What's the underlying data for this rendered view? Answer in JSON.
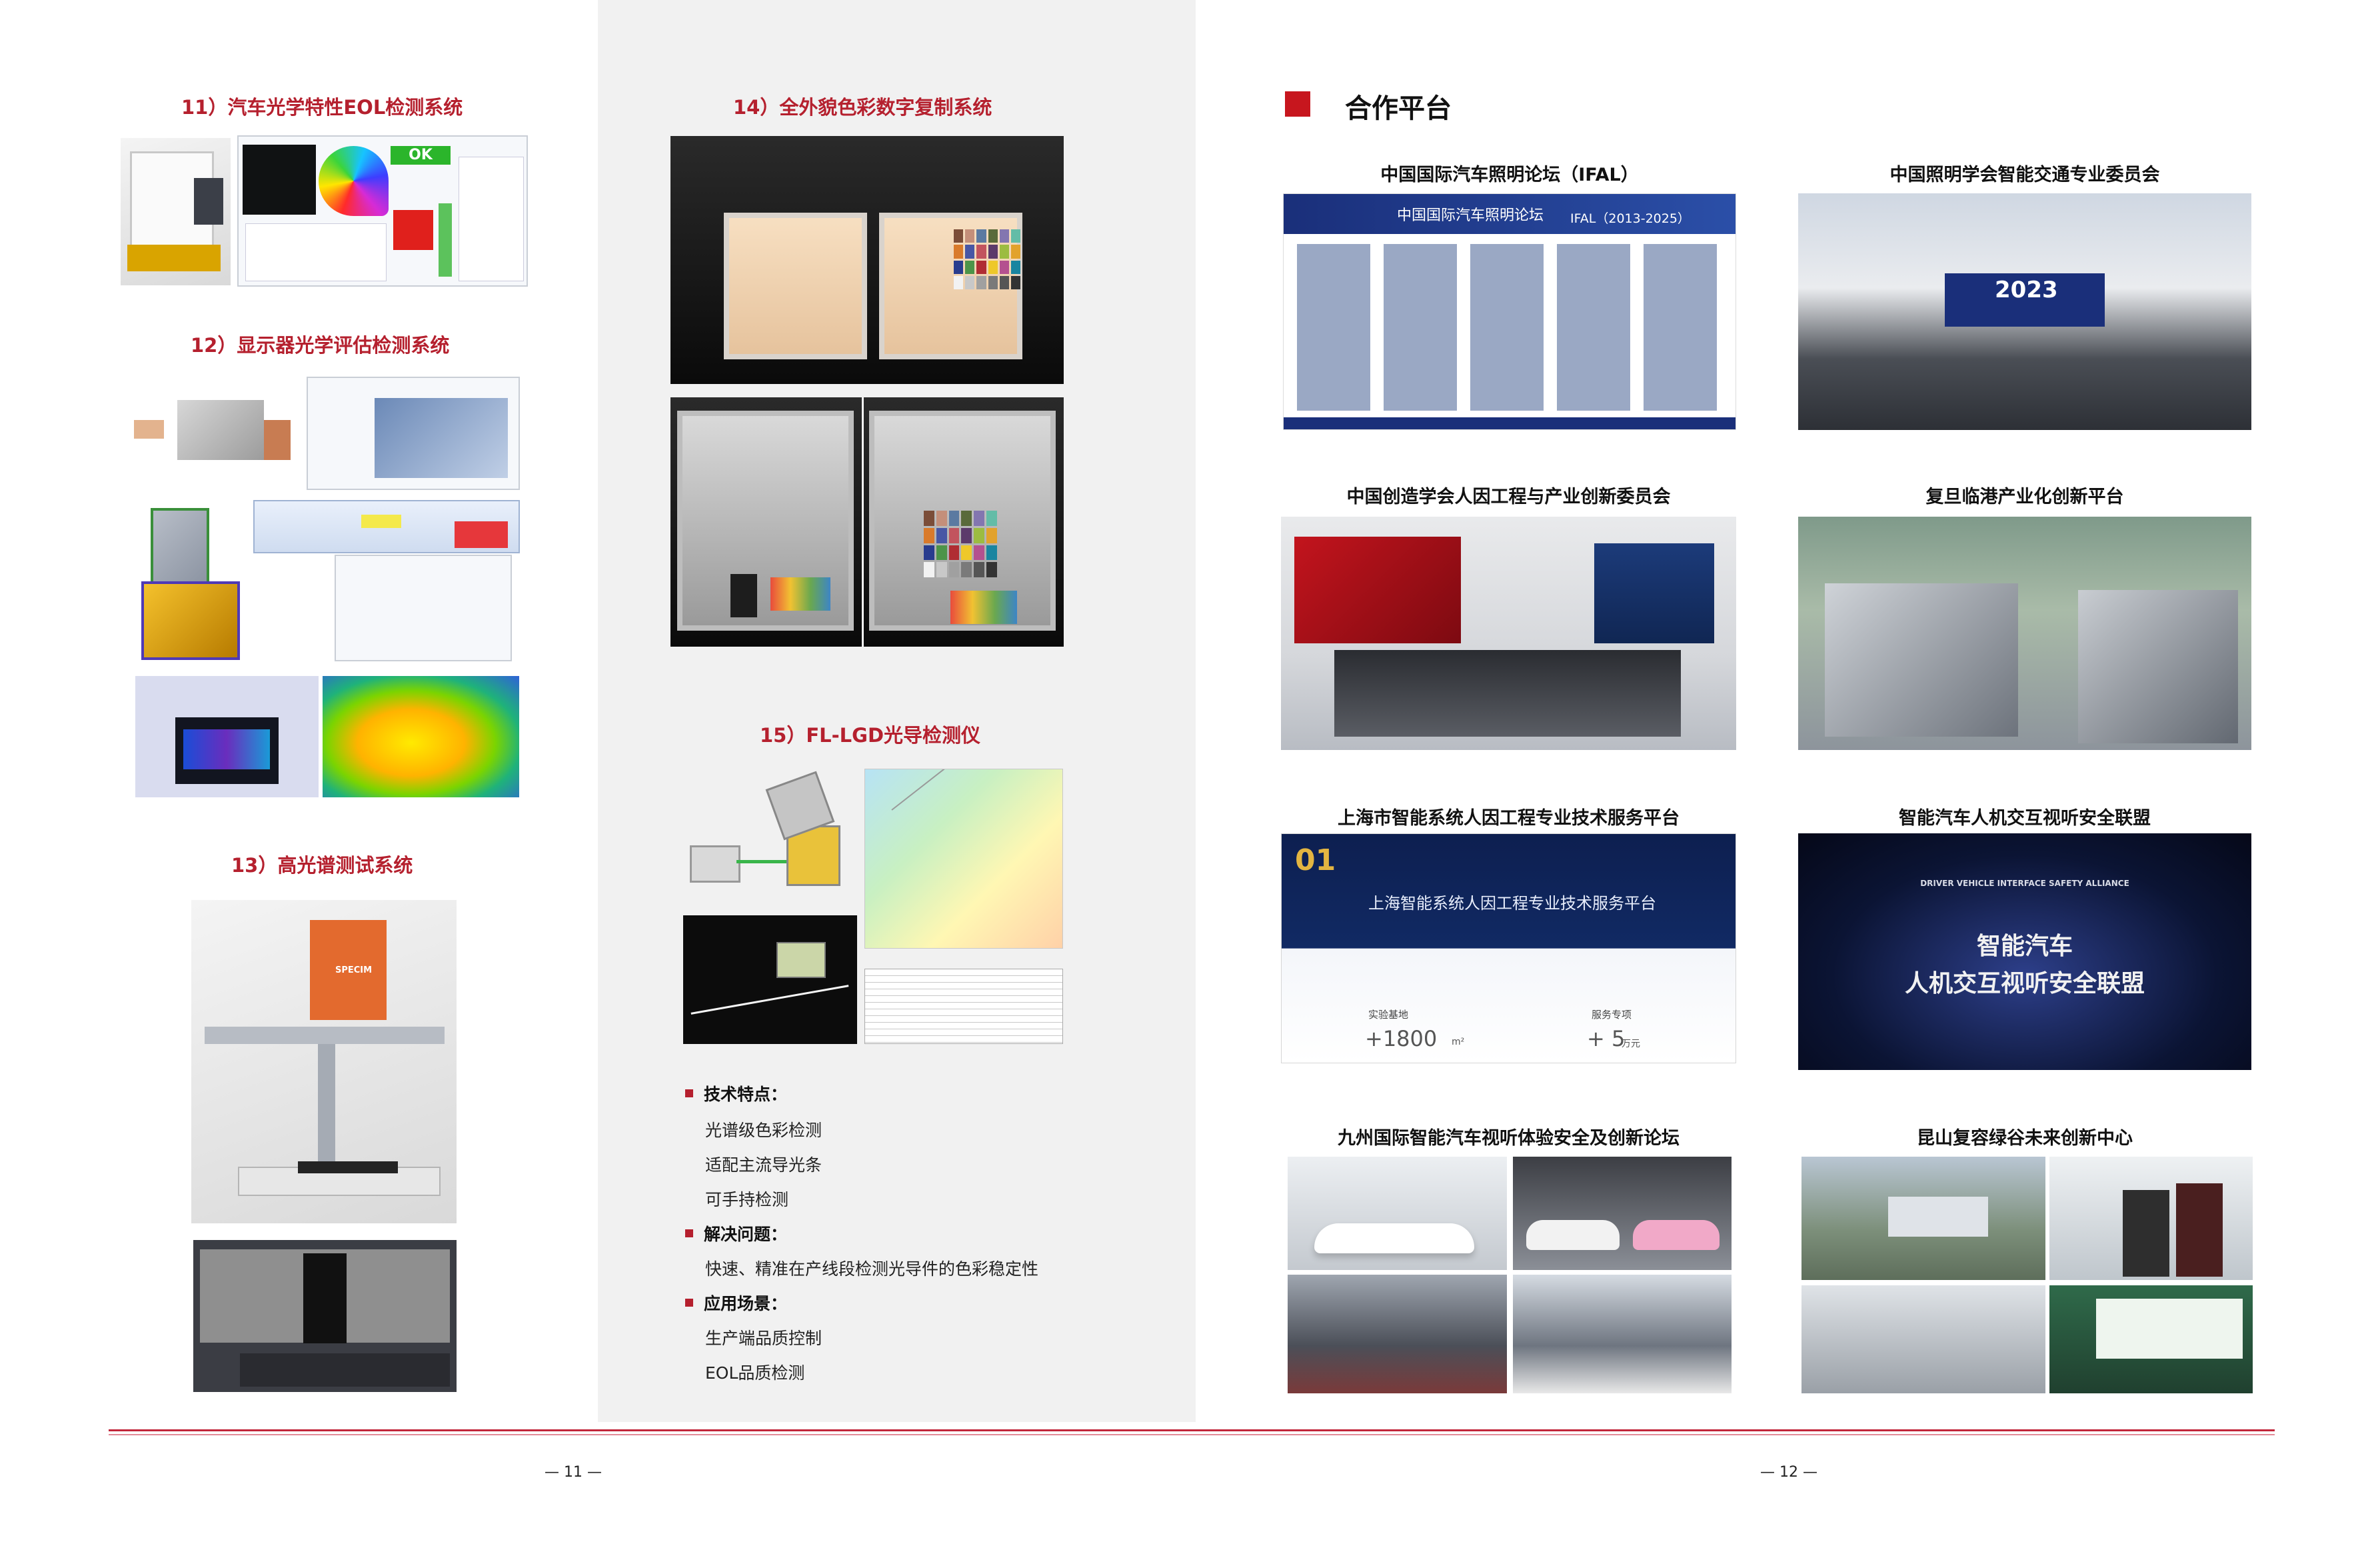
{
  "left_page": {
    "sections": [
      {
        "title": "11）汽车光学特性EOL检测系统",
        "ok_label": "OK"
      },
      {
        "title": "12）显示器光学评估检测系统"
      },
      {
        "title": "13）高光谱测试系统",
        "device_label": "SPECIM"
      }
    ],
    "page_number": "— 11 —"
  },
  "middle_column": {
    "sections": [
      {
        "title": "14）全外貌色彩数字复制系统"
      },
      {
        "title": "15）FL-LGD光导检测仪"
      }
    ],
    "bullets": [
      {
        "heading": "技术特点：",
        "items": [
          "光谱级色彩检测",
          "适配主流导光条",
          "可手持检测"
        ]
      },
      {
        "heading": "解决问题：",
        "items": [
          "快速、精准在产线段检测光导件的色彩稳定性"
        ]
      },
      {
        "heading": "应用场景：",
        "items": [
          "生产端品质控制",
          "EOL品质检测"
        ]
      }
    ]
  },
  "right_page": {
    "title": "合作平台",
    "platforms": [
      {
        "name": "中国国际汽车照明论坛（IFAL）",
        "image_text": [
          "中国国际汽车照明论坛",
          "IFAL（2013-2025）"
        ]
      },
      {
        "name": "中国照明学会智能交通专业委员会",
        "image_text": [
          "2023"
        ]
      },
      {
        "name": "中国创造学会人因工程与产业创新委员会"
      },
      {
        "name": "复旦临港产业化创新平台"
      },
      {
        "name": "上海市智能系统人因工程专业技术服务平台",
        "image_text": [
          "01",
          "上海智能系统人因工程专业技术服务平台",
          "实验基地",
          "+1800",
          "m²",
          "服务专项",
          "+ 5",
          "万元"
        ]
      },
      {
        "name": "智能汽车人机交互视听安全联盟",
        "image_text": [
          "DRIVER VEHICLE INTERFACE SAFETY ALLIANCE",
          "智能汽车",
          "人机交互视听安全联盟"
        ]
      },
      {
        "name": "九州国际智能汽车视听体验安全及创新论坛"
      },
      {
        "name": "昆山复容绿谷未来创新中心"
      }
    ],
    "page_number": "— 12 —"
  },
  "colors": {
    "accent_red": "#b5202e",
    "rule_red": "#c2263a",
    "column_gray": "#f1f1f1"
  }
}
